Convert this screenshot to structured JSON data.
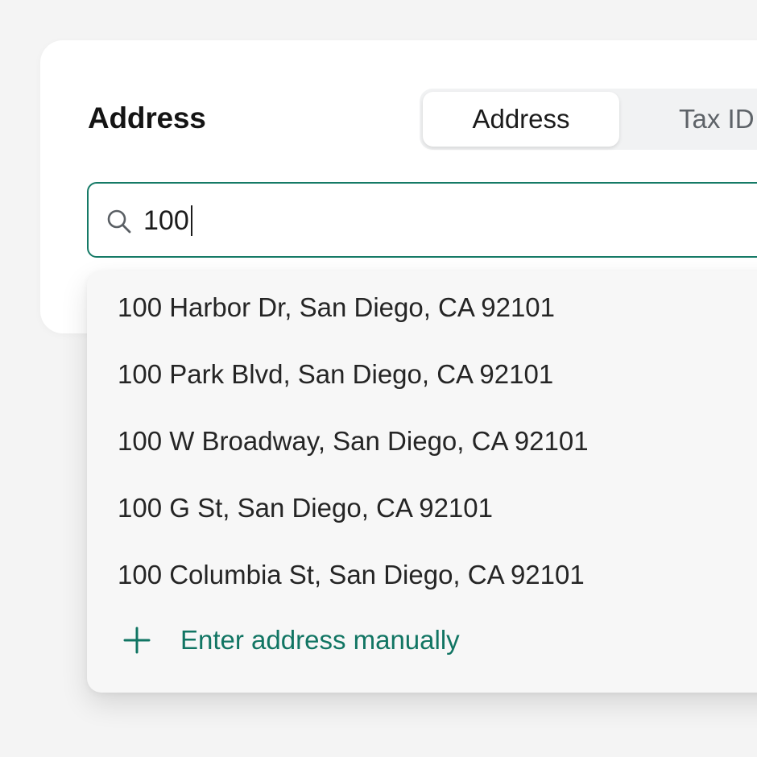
{
  "form": {
    "title": "Address"
  },
  "tabs": [
    {
      "label": "Address",
      "active": true
    },
    {
      "label": "Tax ID",
      "active": false
    }
  ],
  "search": {
    "value": "100",
    "icon": "search-icon"
  },
  "suggestions": [
    "100 Harbor Dr, San Diego, CA 92101",
    "100 Park Blvd, San Diego, CA 92101",
    "100 W Broadway, San Diego, CA 92101",
    "100 G St, San Diego, CA 92101",
    "100 Columbia St, San Diego, CA 92101"
  ],
  "manual_entry": {
    "label": "Enter address manually",
    "icon": "plus-icon"
  },
  "colors": {
    "accent": "#157a66",
    "accent_text": "#117563"
  }
}
